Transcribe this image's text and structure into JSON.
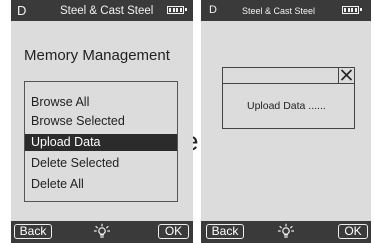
{
  "background_fragment": "e",
  "left_screen": {
    "status_bar": {
      "mode_letter": "D",
      "material": "Steel & Cast Steel",
      "battery_icon": "battery-full-icon"
    },
    "title": "Memory Management",
    "menu": [
      {
        "label": "Browse All",
        "selected": false
      },
      {
        "label": "Browse Selected",
        "selected": false
      },
      {
        "label": "Upload Data",
        "selected": true
      },
      {
        "label": "Delete Selected",
        "selected": false
      },
      {
        "label": "Delete All",
        "selected": false
      }
    ],
    "footer": {
      "back_label": "Back",
      "center_icon": "backlight-bulb-icon",
      "ok_label": "OK"
    }
  },
  "right_screen": {
    "status_bar": {
      "mode_letter": "D",
      "material": "Steel & Cast Steel",
      "battery_icon": "battery-full-icon"
    },
    "dialog": {
      "close_icon": "close-icon",
      "message": "Upload Data ......"
    },
    "footer": {
      "back_label": "Back",
      "center_icon": "backlight-bulb-icon",
      "ok_label": "OK"
    }
  },
  "colors": {
    "bar": "#3a3a3a",
    "screen": "#dcdcdc",
    "selection": "#2b2b2b",
    "bar_text": "#f2f2f2"
  }
}
